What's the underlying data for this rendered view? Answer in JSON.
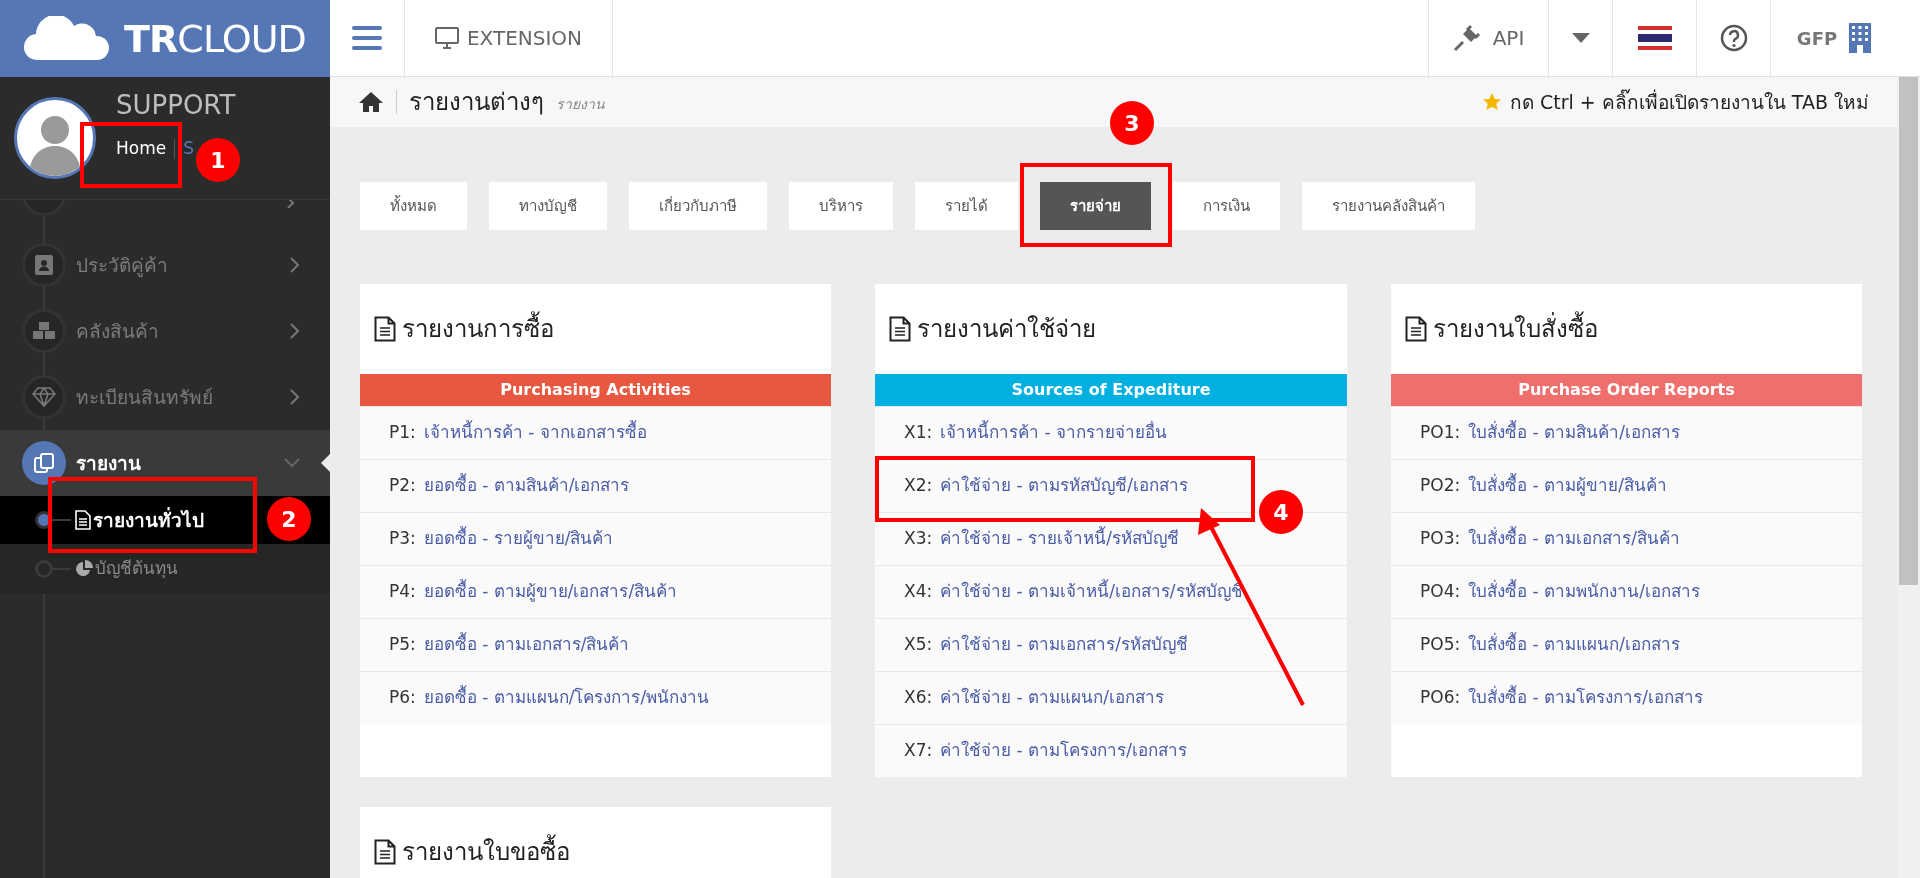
{
  "logo": {
    "bold": "TR",
    "text": "CLOUD"
  },
  "profile": {
    "name": "SUPPORT",
    "links": [
      "Home",
      "S"
    ]
  },
  "sidebar": {
    "items": [
      {
        "label": "ประวัติคู่ค้า",
        "selected": false,
        "expanded": false
      },
      {
        "label": "คลังสินค้า",
        "selected": false,
        "expanded": false
      },
      {
        "label": "ทะเบียนสินทรัพย์",
        "selected": false,
        "expanded": false
      },
      {
        "label": "รายงาน",
        "selected": true,
        "expanded": true,
        "children": [
          {
            "label": "รายงานทั่วไป",
            "selected": true
          },
          {
            "label": "บัญชีต้นทุน",
            "selected": false
          }
        ]
      }
    ]
  },
  "topbar": {
    "extension": "EXTENSION",
    "api": "API",
    "account": "GFP"
  },
  "header": {
    "title": "รายงานต่างๆ",
    "subtitle": "รายงาน",
    "hint": "กด Ctrl + คลิ๊กเพื่อเปิดรายงานใน TAB ใหม่"
  },
  "tabs": [
    {
      "label": "ทั้งหมด",
      "selected": false
    },
    {
      "label": "ทางบัญชี",
      "selected": false
    },
    {
      "label": "เกี่ยวกับภาษี",
      "selected": false
    },
    {
      "label": "บริหาร",
      "selected": false
    },
    {
      "label": "รายได้",
      "selected": false
    },
    {
      "label": "รายจ่าย",
      "selected": true
    },
    {
      "label": "การเงิน",
      "selected": false
    },
    {
      "label": "รายงานคลังสินค้า",
      "selected": false
    }
  ],
  "cards": [
    {
      "title": "รายงานการซื้อ",
      "banner": "Purchasing Activities",
      "color": "#e8573f",
      "rows": [
        {
          "code": "P1:",
          "label": "เจ้าหนี้การค้า - จากเอกสารซื้อ"
        },
        {
          "code": "P2:",
          "label": "ยอดซื้อ - ตามสินค้า/เอกสาร"
        },
        {
          "code": "P3:",
          "label": "ยอดซื้อ - รายผู้ขาย/สินค้า"
        },
        {
          "code": "P4:",
          "label": "ยอดซื้อ - ตามผู้ขาย/เอกสาร/สินค้า"
        },
        {
          "code": "P5:",
          "label": "ยอดซื้อ - ตามเอกสาร/สินค้า"
        },
        {
          "code": "P6:",
          "label": "ยอดซื้อ - ตามแผนก/โครงการ/พนักงาน"
        }
      ]
    },
    {
      "title": "รายงานค่าใช้จ่าย",
      "banner": "Sources of Expediture",
      "color": "#00b0e0",
      "rows": [
        {
          "code": "X1:",
          "label": "เจ้าหนี้การค้า - จากรายจ่ายอื่น"
        },
        {
          "code": "X2:",
          "label": "ค่าใช้จ่าย - ตามรหัสบัญชี/เอกสาร"
        },
        {
          "code": "X3:",
          "label": "ค่าใช้จ่าย - รายเจ้าหนี้/รหัสบัญชี"
        },
        {
          "code": "X4:",
          "label": "ค่าใช้จ่าย - ตามเจ้าหนี้/เอกสาร/รหัสบัญชี"
        },
        {
          "code": "X5:",
          "label": "ค่าใช้จ่าย - ตามเอกสาร/รหัสบัญชี"
        },
        {
          "code": "X6:",
          "label": "ค่าใช้จ่าย - ตามแผนก/เอกสาร"
        },
        {
          "code": "X7:",
          "label": "ค่าใช้จ่าย - ตามโครงการ/เอกสาร"
        }
      ]
    },
    {
      "title": "รายงานใบสั่งซื้อ",
      "banner": "Purchase Order Reports",
      "color": "#ef6f6c",
      "rows": [
        {
          "code": "PO1:",
          "label": "ใบสั่งซื้อ - ตามสินค้า/เอกสาร"
        },
        {
          "code": "PO2:",
          "label": "ใบสั่งซื้อ - ตามผู้ขาย/สินค้า"
        },
        {
          "code": "PO3:",
          "label": "ใบสั่งซื้อ - ตามเอกสาร/สินค้า"
        },
        {
          "code": "PO4:",
          "label": "ใบสั่งซื้อ - ตามพนักงาน/เอกสาร"
        },
        {
          "code": "PO5:",
          "label": "ใบสั่งซื้อ - ตามแผนก/เอกสาร"
        },
        {
          "code": "PO6:",
          "label": "ใบสั่งซื้อ - ตามโครงการ/เอกสาร"
        }
      ]
    },
    {
      "title": "รายงานใบขอซื้อ"
    }
  ],
  "annotations": [
    {
      "number": "1"
    },
    {
      "number": "2"
    },
    {
      "number": "3"
    },
    {
      "number": "4"
    }
  ]
}
